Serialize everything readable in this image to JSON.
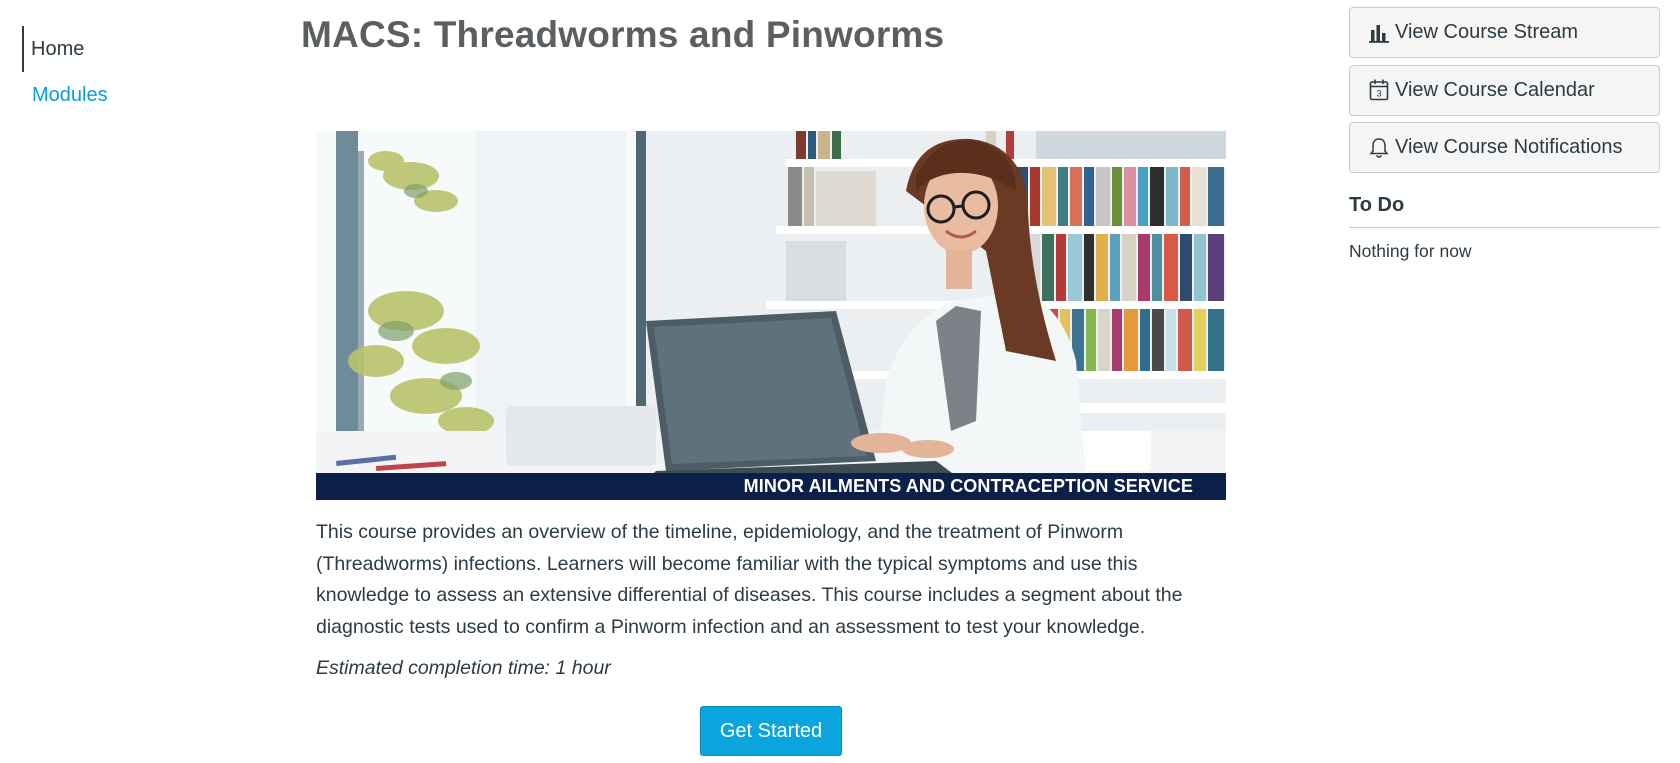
{
  "nav": {
    "items": [
      {
        "label": "Home",
        "active": true
      },
      {
        "label": "Modules",
        "active": false
      }
    ]
  },
  "main": {
    "title": "MACS: Threadworms and Pinworms",
    "banner": {
      "caption": "MINOR AILMENTS AND CONTRACEPTION SERVICE",
      "image": "woman-with-laptop-photo"
    },
    "description": "This course provides an overview of the timeline, epidemiology, and the treatment of Pinworm (Threadworms) infections. Learners will become familiar with the typical symptoms and use this knowledge to assess an extensive differential of diseases. This course includes a segment about the diagnostic tests used to confirm a Pinworm infection and an assessment to test your knowledge.",
    "estimate": "Estimated completion time: 1 hour",
    "get_started_label": "Get Started"
  },
  "sidebar": {
    "buttons": [
      {
        "label": "View Course Stream",
        "icon": "bar-chart-icon"
      },
      {
        "label": "View Course Calendar",
        "icon": "calendar-icon"
      },
      {
        "label": "View Course Notifications",
        "icon": "bell-icon"
      }
    ],
    "todo": {
      "title": "To Do",
      "empty_text": "Nothing for now"
    }
  },
  "colors": {
    "link": "#0a9ed6",
    "button": "#0aa5dc",
    "banner_bar": "#0b1f48",
    "title": "#5b5f62"
  }
}
